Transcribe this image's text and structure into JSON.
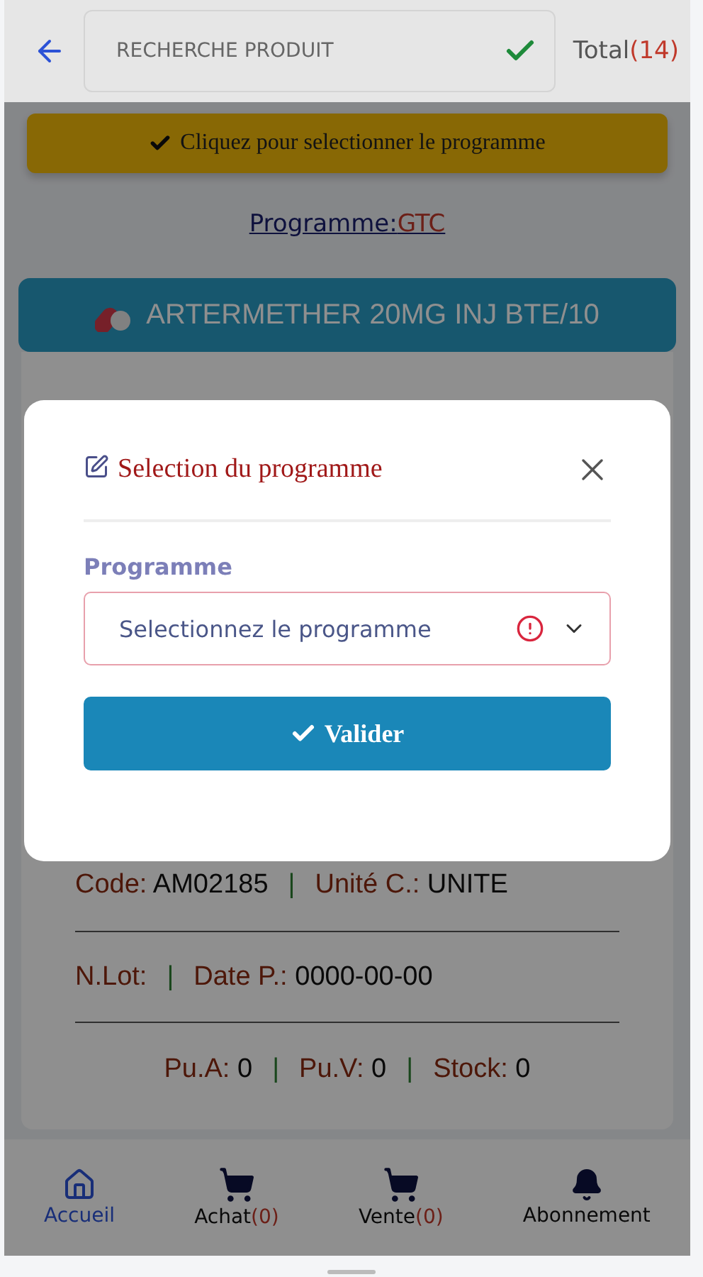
{
  "header": {
    "search_placeholder": "RECHERCHE PRODUIT",
    "validated": true,
    "total_label": "Total",
    "total_count": "(14)"
  },
  "banner": {
    "text": "Cliquez pour selectionner le programme"
  },
  "program_link": {
    "label": "Programme:",
    "value": "GTC"
  },
  "product": {
    "name": "ARTERMETHER 20MG INJ BTE/10"
  },
  "details": [
    {
      "separator": "|",
      "fields": [
        {
          "label": "Code:",
          "value": "AM02185"
        },
        {
          "label": "Unité C.:",
          "value": "UNITE"
        }
      ]
    },
    {
      "separator": "|",
      "fields": [
        {
          "label": "N.Lot:"
        },
        {
          "label": "Date P.:",
          "value": "0000-00-00"
        }
      ]
    },
    {
      "separator": "|",
      "fields": [
        {
          "label": "Pu.A:",
          "value": "0"
        },
        {
          "label": "Pu.V:",
          "value": "0"
        },
        {
          "label": "Stock:",
          "value": "0"
        }
      ],
      "centered": true
    }
  ],
  "bottom_nav": [
    {
      "kind": "home",
      "label": "Accueil",
      "selected": true
    },
    {
      "kind": "cart",
      "label": "Achat",
      "count": "(0)",
      "selected": false
    },
    {
      "kind": "cart",
      "label": "Vente",
      "count": "(0)",
      "selected": false
    },
    {
      "kind": "bell",
      "label": "Abonnement",
      "selected": false
    }
  ],
  "modal": {
    "title": "Selection du programme",
    "field_label": "Programme",
    "placeholder": "Selectionnez le programme",
    "invalid": true,
    "button": "Valider"
  }
}
